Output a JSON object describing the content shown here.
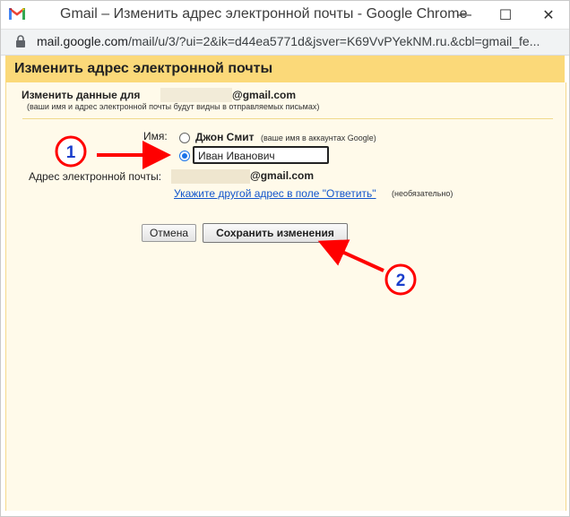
{
  "window": {
    "title": "Gmail – Изменить адрес электронной почты - Google Chrome",
    "minimize_glyph": "—",
    "maximize_glyph": "☐",
    "close_glyph": "✕"
  },
  "address_bar": {
    "url_host": "mail.google.com",
    "url_rest": "/mail/u/3/?ui=2&ik=d44ea5771d&jsver=K69VvPYekNM.ru.&cbl=gmail_fe..."
  },
  "dialog": {
    "title": "Изменить адрес электронной почты",
    "edit_for_label": "Изменить данные для",
    "email_domain": "@gmail.com",
    "visibility_hint": "(ваши имя и адрес электронной почты будут видны в отправляемых письмах)",
    "name_label": "Имя:",
    "option_account_name": "Джон Смит",
    "option_account_hint": "(ваше имя в аккаунтах Google)",
    "custom_name_value": "Иван Иванович",
    "email_label": "Адрес электронной почты:",
    "reply_to_link": "Укажите другой адрес в поле \"Ответить\"",
    "optional_hint": "(необязательно)",
    "cancel_button": "Отмена",
    "save_button": "Сохранить изменения"
  },
  "annotations": {
    "badge1": "1",
    "badge2": "2",
    "color": "#ff0000"
  },
  "colors": {
    "header_bg": "#fbd979",
    "content_bg": "#fffaea",
    "link": "#1155cc",
    "radio_selected": "#1a73e8"
  }
}
